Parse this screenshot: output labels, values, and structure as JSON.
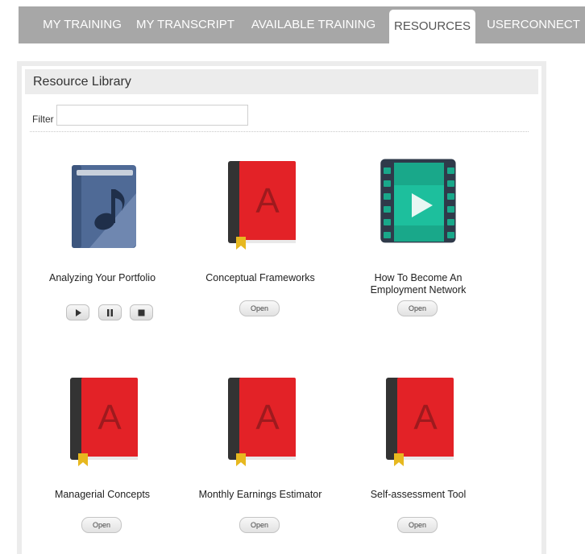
{
  "tabs": [
    {
      "label": "MY TRAINING"
    },
    {
      "label": "MY TRANSCRIPT"
    },
    {
      "label": "AVAILABLE TRAINING"
    },
    {
      "label": "RESOURCES",
      "active": true
    },
    {
      "label": "USERCONNECT"
    }
  ],
  "library": {
    "title": "Resource Library",
    "filter_label": "Filter",
    "filter_value": ""
  },
  "resources": [
    {
      "title": "Analyzing Your Portfolio",
      "icon": "music-book-icon",
      "controls": [
        "play-icon",
        "pause-icon",
        "stop-icon"
      ]
    },
    {
      "title": "Conceptual Frameworks",
      "icon": "red-book-icon",
      "button": "Open"
    },
    {
      "title": "How To Become An Employment Network",
      "icon": "video-film-icon",
      "button": "Open"
    },
    {
      "title": "Managerial Concepts",
      "icon": "red-book-icon",
      "button": "Open"
    },
    {
      "title": "Monthly Earnings Estimator",
      "icon": "red-book-icon",
      "button": "Open"
    },
    {
      "title": "Self-assessment Tool",
      "icon": "red-book-icon",
      "button": "Open"
    }
  ],
  "colors": {
    "tab_bar": "#a7a7a7",
    "book_red": "#e32227",
    "book_spine": "#333333",
    "film_teal": "#19a88a",
    "music_book_blue": "#4f6a96"
  }
}
